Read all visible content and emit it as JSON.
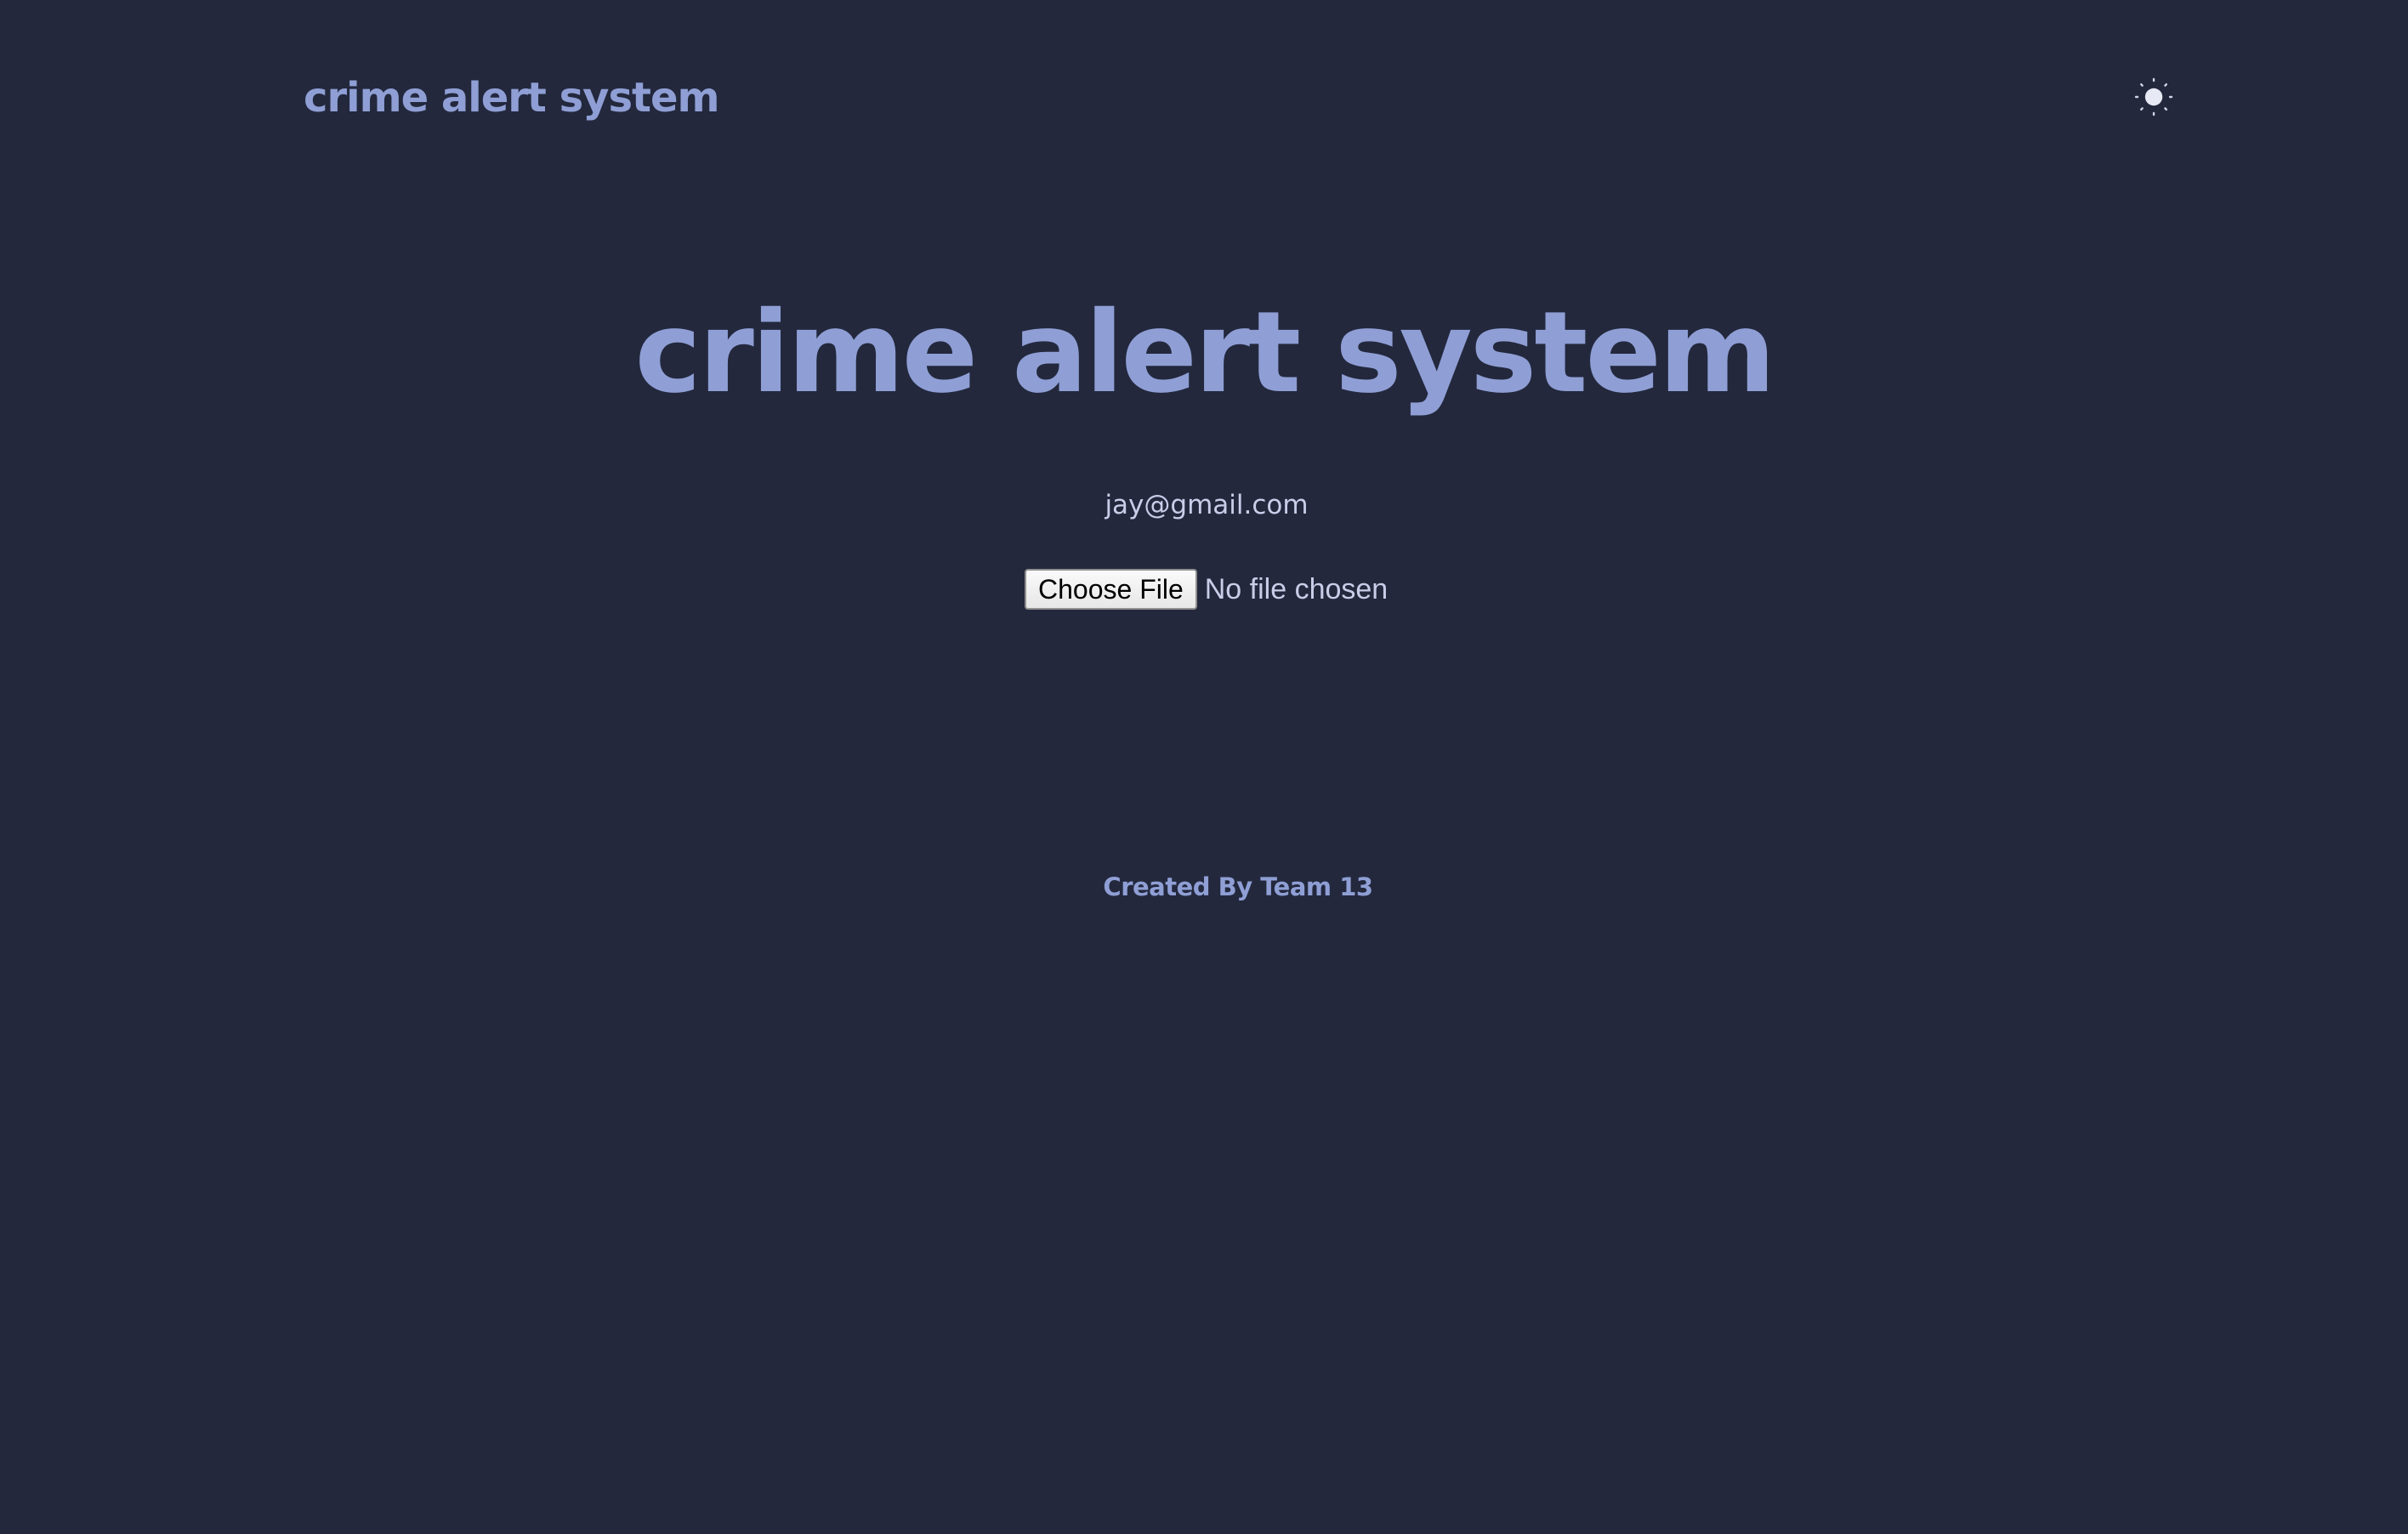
{
  "header": {
    "brand": "crime alert system",
    "theme_toggle_icon": "sun-icon"
  },
  "main": {
    "title": "crime alert system",
    "email": "jay@gmail.com",
    "file_input": {
      "button_label": "Choose File",
      "status_text": "No file chosen"
    }
  },
  "footer": {
    "credit": "Created By Team 13"
  },
  "colors": {
    "background": "#23283d",
    "accent": "#8f9fd5",
    "muted_text": "#c8cee8",
    "button_bg": "#efefef"
  }
}
